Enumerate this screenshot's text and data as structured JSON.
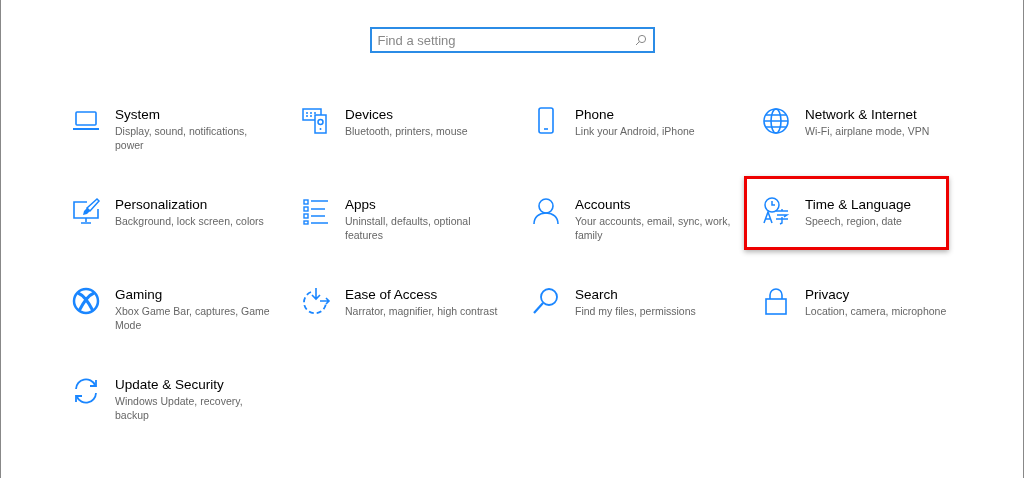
{
  "search": {
    "placeholder": "Find a setting"
  },
  "categories": [
    {
      "title": "System",
      "description": "Display, sound, notifications, power",
      "highlighted": false
    },
    {
      "title": "Devices",
      "description": "Bluetooth, printers, mouse",
      "highlighted": false
    },
    {
      "title": "Phone",
      "description": "Link your Android, iPhone",
      "highlighted": false
    },
    {
      "title": "Network & Internet",
      "description": "Wi-Fi, airplane mode, VPN",
      "highlighted": false
    },
    {
      "title": "Personalization",
      "description": "Background, lock screen, colors",
      "highlighted": false
    },
    {
      "title": "Apps",
      "description": "Uninstall, defaults, optional features",
      "highlighted": false
    },
    {
      "title": "Accounts",
      "description": "Your accounts, email, sync, work, family",
      "highlighted": false
    },
    {
      "title": "Time & Language",
      "description": "Speech, region, date",
      "highlighted": true
    },
    {
      "title": "Gaming",
      "description": "Xbox Game Bar, captures, Game Mode",
      "highlighted": false
    },
    {
      "title": "Ease of Access",
      "description": "Narrator, magnifier, high contrast",
      "highlighted": false
    },
    {
      "title": "Search",
      "description": "Find my files, permissions",
      "highlighted": false
    },
    {
      "title": "Privacy",
      "description": "Location, camera, microphone",
      "highlighted": false
    },
    {
      "title": "Update & Security",
      "description": "Windows Update, recovery, backup",
      "highlighted": false
    }
  ]
}
